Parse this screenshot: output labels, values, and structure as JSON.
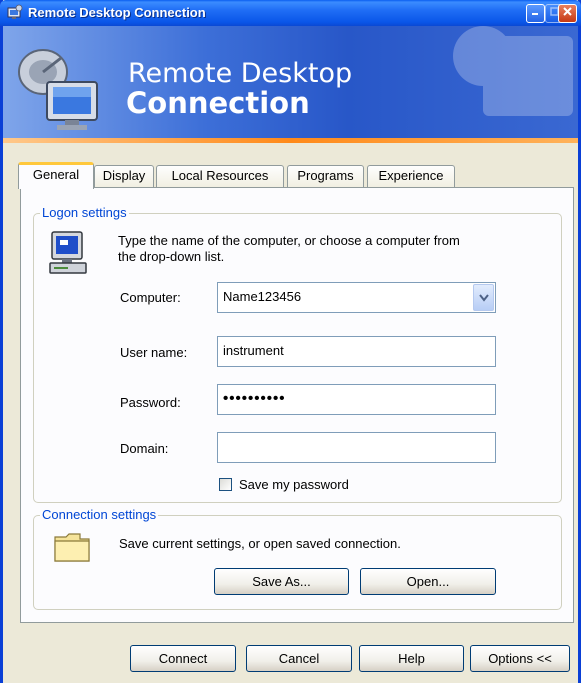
{
  "window": {
    "title": "Remote Desktop Connection"
  },
  "banner": {
    "line1": "Remote Desktop",
    "line2": "Connection"
  },
  "tabs": [
    {
      "label": "General"
    },
    {
      "label": "Display"
    },
    {
      "label": "Local Resources"
    },
    {
      "label": "Programs"
    },
    {
      "label": "Experience"
    }
  ],
  "logon": {
    "group_label": "Logon settings",
    "instructions_line1": "Type the name of the computer, or choose a computer from",
    "instructions_line2": "the drop-down list.",
    "computer_label": "Computer:",
    "computer_value": "Name123456",
    "username_label": "User name:",
    "username_value": "instrument",
    "password_label": "Password:",
    "password_value": "••••••••••",
    "domain_label": "Domain:",
    "domain_value": "",
    "save_password_label": "Save my password",
    "save_password_checked": false
  },
  "connection": {
    "group_label": "Connection settings",
    "text": "Save current settings, or open saved connection.",
    "save_as_label": "Save As...",
    "open_label": "Open..."
  },
  "footer": {
    "connect_label": "Connect",
    "cancel_label": "Cancel",
    "help_label": "Help",
    "options_label": "Options <<"
  },
  "colors": {
    "title_bar": "#0a56e8",
    "banner": "#2857c8",
    "accent_orange": "#ff8a1a",
    "group_label": "#0046d5",
    "face": "#ece9d8"
  },
  "icons": {
    "title": "remote-desktop-icon",
    "banner": "remote-desktop-computer-icon",
    "logon": "computer-monitor-icon",
    "connection": "folder-icon"
  }
}
